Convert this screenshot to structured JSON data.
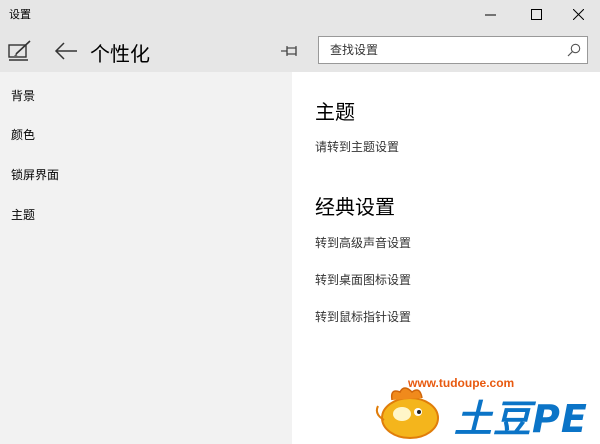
{
  "window": {
    "title": "设置",
    "icons": {
      "minimize": "minimize-icon",
      "maximize": "maximize-icon",
      "close": "close-icon"
    }
  },
  "header": {
    "app_icon": "personalization-icon",
    "back_icon": "back-arrow-icon",
    "title": "个性化",
    "pin_icon": "pin-icon",
    "search": {
      "placeholder": "查找设置",
      "value": "",
      "icon": "search-icon"
    }
  },
  "sidebar": {
    "items": [
      {
        "label": "背景"
      },
      {
        "label": "颜色"
      },
      {
        "label": "锁屏界面"
      },
      {
        "label": "主题"
      }
    ]
  },
  "main": {
    "sections": [
      {
        "title": "主题",
        "links": [
          "请转到主题设置"
        ]
      },
      {
        "title": "经典设置",
        "links": [
          "转到高级声音设置",
          "转到桌面图标设置",
          "转到鼠标指针设置"
        ]
      }
    ]
  },
  "watermark": {
    "url": "www.tudoupe.com",
    "brand": "土豆PE"
  },
  "colors": {
    "accent": "#0b74c7",
    "watermark_orange": "#e85a10",
    "header_bg": "#e6e6e6",
    "sidebar_bg": "#f2f2f2"
  }
}
